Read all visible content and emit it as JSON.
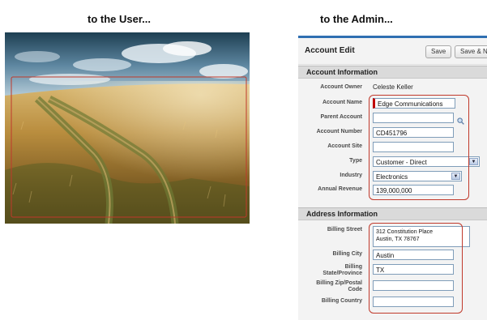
{
  "captions": {
    "user": "to the User...",
    "admin": "to the Admin..."
  },
  "form": {
    "title": "Account Edit",
    "buttons": {
      "save": "Save",
      "save_new": "Save & N"
    },
    "sections": {
      "account_info": "Account Information",
      "address_info": "Address Information"
    },
    "account": {
      "owner_label": "Account Owner",
      "owner_value": "Celeste Keller",
      "name_label": "Account Name",
      "name_value": "Edge Communications",
      "parent_label": "Parent Account",
      "parent_value": "",
      "number_label": "Account Number",
      "number_value": "CD451796",
      "site_label": "Account Site",
      "site_value": "",
      "type_label": "Type",
      "type_value": "Customer - Direct",
      "industry_label": "Industry",
      "industry_value": "Electronics",
      "revenue_label": "Annual Revenue",
      "revenue_value": "139,000,000"
    },
    "address": {
      "street_label": "Billing Street",
      "street_line1": "312 Constitution Place",
      "street_line2": "Austin, TX 78767",
      "city_label": "Billing City",
      "city_value": "Austin",
      "state_label_1": "Billing",
      "state_label_2": "State/Province",
      "state_value": "TX",
      "zip_label_1": "Billing Zip/Postal",
      "zip_label_2": "Code",
      "zip_value": "",
      "country_label": "Billing Country",
      "country_value": ""
    }
  },
  "icons": {
    "lookup": "magnifier-icon",
    "dropdown": "chevron-down-icon"
  },
  "colors": {
    "highlight": "#c0392b",
    "required": "#c00000",
    "header_accent": "#2f6fb1"
  }
}
